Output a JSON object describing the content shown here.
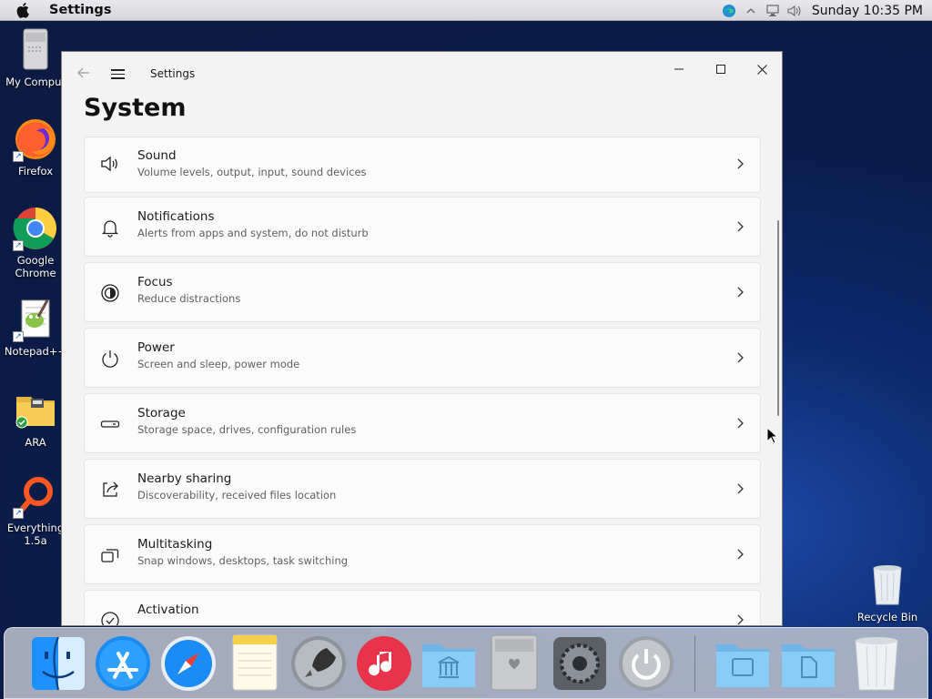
{
  "menubar": {
    "app_name": "Settings",
    "clock": "Sunday 10:35 PM",
    "tray_icons": [
      "edge-icon",
      "chevron-icon",
      "network-icon",
      "volume-icon"
    ]
  },
  "desktop": {
    "icons": [
      {
        "label": "My Comput",
        "icon": "computer-icon"
      },
      {
        "label": "Firefox",
        "icon": "firefox-icon"
      },
      {
        "label": "Google Chrome",
        "icon": "chrome-icon"
      },
      {
        "label": "Notepad++",
        "icon": "notepadpp-icon"
      },
      {
        "label": "ARA",
        "icon": "folder-icon"
      },
      {
        "label": "Everything 1.5a",
        "icon": "everything-icon"
      },
      {
        "label": "Recycle Bin",
        "icon": "recycle-bin-icon"
      }
    ]
  },
  "window": {
    "title": "Settings",
    "page_title": "System",
    "items": [
      {
        "title": "Sound",
        "subtitle": "Volume levels, output, input, sound devices",
        "icon": "speaker-icon"
      },
      {
        "title": "Notifications",
        "subtitle": "Alerts from apps and system, do not disturb",
        "icon": "bell-icon"
      },
      {
        "title": "Focus",
        "subtitle": "Reduce distractions",
        "icon": "focus-icon"
      },
      {
        "title": "Power",
        "subtitle": "Screen and sleep, power mode",
        "icon": "power-icon"
      },
      {
        "title": "Storage",
        "subtitle": "Storage space, drives, configuration rules",
        "icon": "storage-icon"
      },
      {
        "title": "Nearby sharing",
        "subtitle": "Discoverability, received files location",
        "icon": "share-icon"
      },
      {
        "title": "Multitasking",
        "subtitle": "Snap windows, desktops, task switching",
        "icon": "multitasking-icon"
      },
      {
        "title": "Activation",
        "subtitle": "",
        "icon": "activation-icon"
      }
    ]
  },
  "dock": {
    "items": [
      "finder-icon",
      "app-store-icon",
      "safari-icon",
      "notes-icon",
      "launchpad-icon",
      "music-icon",
      "applications-folder-icon",
      "mac-pro-icon",
      "system-preferences-icon",
      "power-icon",
      "documents-folder-icon",
      "files-folder-icon",
      "trash-icon"
    ]
  },
  "colors": {
    "window_bg": "#f3f3f3",
    "card_bg": "#fbfbfb",
    "desktop_bg": "#0b1a3f"
  }
}
